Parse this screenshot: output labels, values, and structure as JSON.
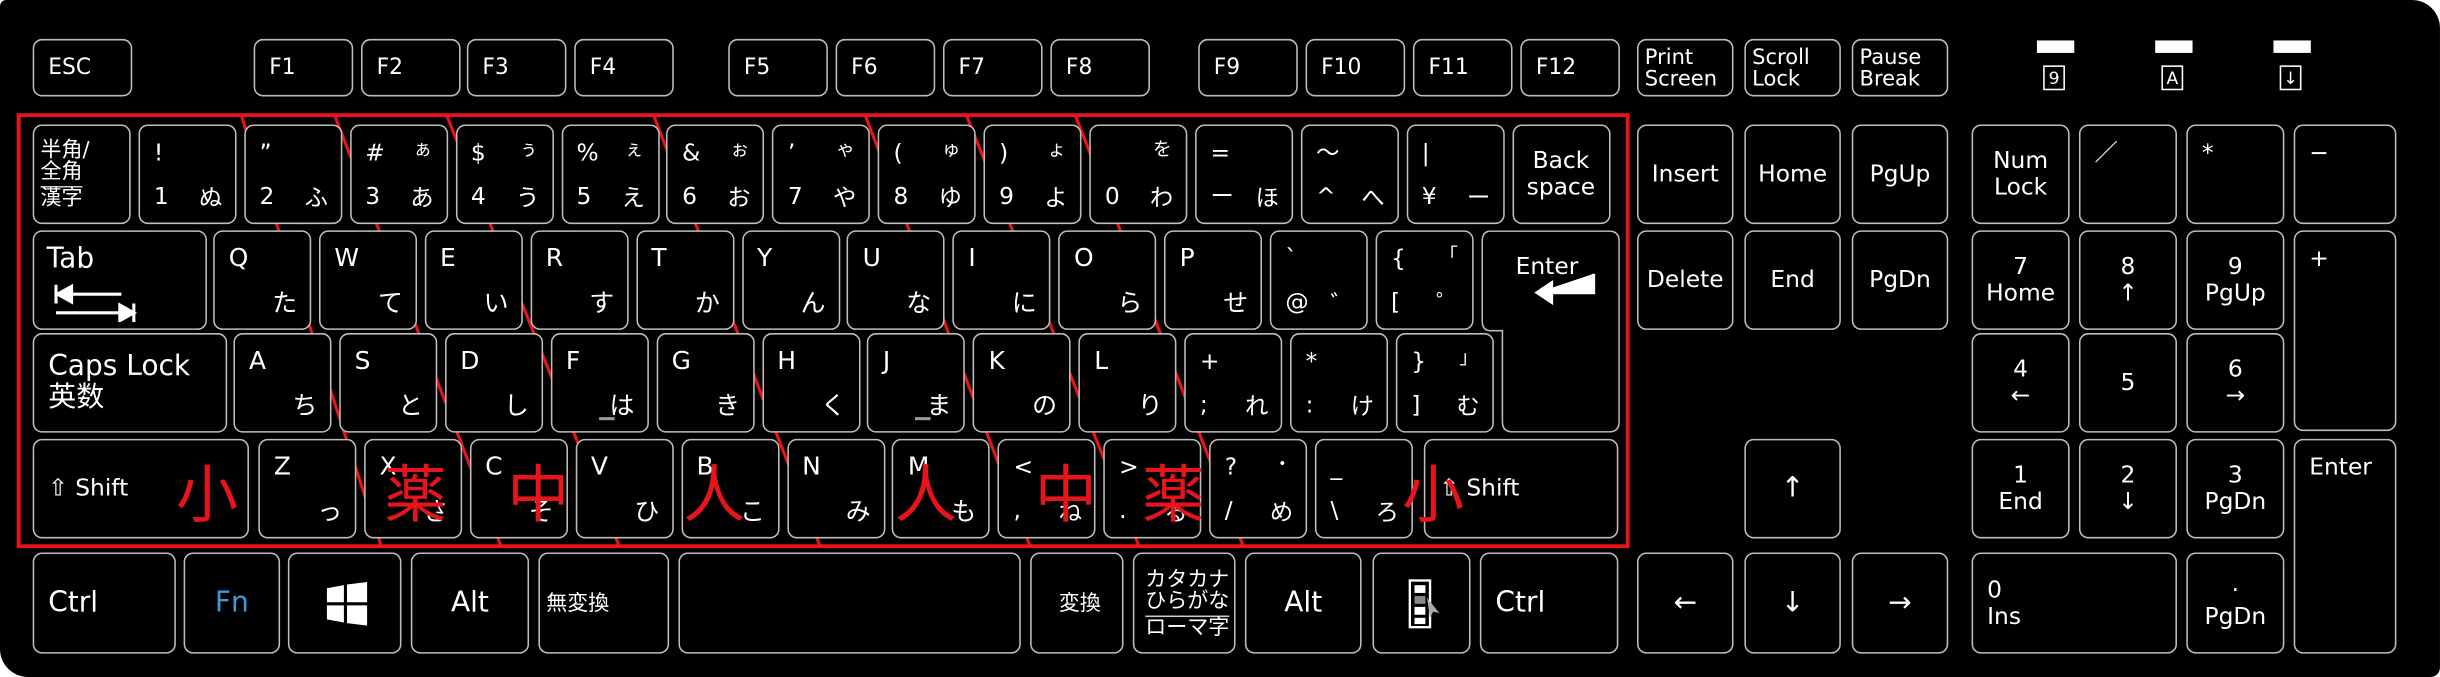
{
  "accent_colors": {
    "overlay_red": "#e8141c",
    "fn_blue": "#3d9ad8",
    "key_border": "#bdbdbd",
    "keyboard_body": "#000000"
  },
  "function_row": [
    {
      "lines": [
        "ESC"
      ]
    },
    {
      "lines": [
        "F1"
      ]
    },
    {
      "lines": [
        "F2"
      ]
    },
    {
      "lines": [
        "F3"
      ]
    },
    {
      "lines": [
        "F4"
      ]
    },
    {
      "lines": [
        "F5"
      ]
    },
    {
      "lines": [
        "F6"
      ]
    },
    {
      "lines": [
        "F7"
      ]
    },
    {
      "lines": [
        "F8"
      ]
    },
    {
      "lines": [
        "F9"
      ]
    },
    {
      "lines": [
        "F10"
      ]
    },
    {
      "lines": [
        "F11"
      ]
    },
    {
      "lines": [
        "F12"
      ]
    },
    {
      "lines": [
        "Print",
        "Screen"
      ]
    },
    {
      "lines": [
        "Scroll",
        "Lock"
      ]
    },
    {
      "lines": [
        "Pause",
        "Break"
      ]
    }
  ],
  "indicators": [
    {
      "symbol": "9",
      "name": "num-lock"
    },
    {
      "symbol": "A",
      "name": "caps-lock"
    },
    {
      "symbol": "↓",
      "name": "scroll-lock"
    }
  ],
  "main": {
    "row1": [
      {
        "lines": [
          "半角/",
          "全角",
          "漢字"
        ]
      },
      {
        "tl": "!",
        "bl": "1",
        "br": "ぬ"
      },
      {
        "tl": "”",
        "bl": "2",
        "br": "ふ"
      },
      {
        "tl": "#",
        "tr": "ぁ",
        "bl": "3",
        "br": "あ"
      },
      {
        "tl": "$",
        "tr": "ぅ",
        "bl": "4",
        "br": "う"
      },
      {
        "tl": "%",
        "tr": "ぇ",
        "bl": "5",
        "br": "え"
      },
      {
        "tl": "&",
        "tr": "ぉ",
        "bl": "6",
        "br": "お"
      },
      {
        "tl": "’",
        "tr": "ゃ",
        "bl": "7",
        "br": "や"
      },
      {
        "tl": "(",
        "tr": "ゅ",
        "bl": "8",
        "br": "ゆ"
      },
      {
        "tl": ")",
        "tr": "ょ",
        "bl": "9",
        "br": "よ"
      },
      {
        "tr": "を",
        "bl": "0",
        "br": "わ"
      },
      {
        "tl": "=",
        "bl": "ー",
        "br": "ほ"
      },
      {
        "tl": "～",
        "bl": "^",
        "br": "へ"
      },
      {
        "tl": "|",
        "bl": "¥",
        "br": "ー"
      },
      {
        "lines": [
          "Back",
          "space"
        ]
      }
    ],
    "row2": [
      {
        "lines": [
          "Tab"
        ]
      },
      {
        "tl": "Q",
        "br": "た"
      },
      {
        "tl": "W",
        "br": "て"
      },
      {
        "tl": "E",
        "br": "い"
      },
      {
        "tl": "R",
        "br": "す"
      },
      {
        "tl": "T",
        "br": "か"
      },
      {
        "tl": "Y",
        "br": "ん"
      },
      {
        "tl": "U",
        "br": "な"
      },
      {
        "tl": "I",
        "br": "に"
      },
      {
        "tl": "O",
        "br": "ら"
      },
      {
        "tl": "P",
        "br": "せ"
      },
      {
        "tl": "`",
        "bl": "@",
        "br": "゛"
      },
      {
        "tl": "{",
        "tr": "「",
        "bl": "[",
        "br": "゜"
      }
    ],
    "enter": {
      "label": "Enter"
    },
    "row3": [
      {
        "lines": [
          "Caps Lock",
          "英数"
        ]
      },
      {
        "tl": "A",
        "br": "ち"
      },
      {
        "tl": "S",
        "br": "と"
      },
      {
        "tl": "D",
        "br": "し"
      },
      {
        "tl": "F",
        "br": "は"
      },
      {
        "tl": "G",
        "br": "き"
      },
      {
        "tl": "H",
        "br": "く"
      },
      {
        "tl": "J",
        "br": "ま"
      },
      {
        "tl": "K",
        "br": "の"
      },
      {
        "tl": "L",
        "br": "り"
      },
      {
        "tl": "+",
        "bl": ";",
        "br": "れ"
      },
      {
        "tl": "*",
        "bl": ":",
        "br": "け"
      },
      {
        "tl": "}",
        "tr": "」",
        "bl": "]",
        "br": "む"
      }
    ],
    "row4": [
      {
        "lines": [
          "⇧ Shift"
        ]
      },
      {
        "tl": "Z",
        "br": "っ"
      },
      {
        "tl": "X",
        "br": "さ"
      },
      {
        "tl": "C",
        "br": "そ"
      },
      {
        "tl": "V",
        "br": "ひ"
      },
      {
        "tl": "B",
        "br": "こ"
      },
      {
        "tl": "N",
        "br": "み"
      },
      {
        "tl": "M",
        "br": "も"
      },
      {
        "tl": "<",
        "bl": ",",
        "br": "ね"
      },
      {
        "tl": ">",
        "bl": ".",
        "br": "る"
      },
      {
        "tl": "?",
        "tr": "・",
        "bl": "/",
        "br": "め"
      },
      {
        "tl": "_",
        "bl": "\\",
        "br": "ろ"
      },
      {
        "lines": [
          "⇧ Shift"
        ]
      }
    ],
    "row5": [
      {
        "lines": [
          "Ctrl"
        ]
      },
      {
        "lines": [
          "Fn"
        ]
      },
      {
        "icon": "windows-icon"
      },
      {
        "lines": [
          "Alt"
        ]
      },
      {
        "lines": [
          "無変換"
        ]
      },
      {
        "lines": [
          ""
        ]
      },
      {
        "lines": [
          "変換"
        ]
      },
      {
        "lines": [
          "カタカナ",
          "ひらがな",
          "ローマ字"
        ]
      },
      {
        "lines": [
          "Alt"
        ]
      },
      {
        "icon": "context-menu-icon"
      },
      {
        "lines": [
          "Ctrl"
        ]
      }
    ]
  },
  "nav": [
    {
      "lines": [
        "Insert"
      ]
    },
    {
      "lines": [
        "Home"
      ]
    },
    {
      "lines": [
        "PgUp"
      ]
    },
    {
      "lines": [
        "Delete"
      ]
    },
    {
      "lines": [
        "End"
      ]
    },
    {
      "lines": [
        "PgDn"
      ]
    },
    {
      "lines": [
        "↑"
      ]
    },
    {
      "lines": [
        "←"
      ]
    },
    {
      "lines": [
        "↓"
      ]
    },
    {
      "lines": [
        "→"
      ]
    }
  ],
  "numpad": [
    {
      "lines": [
        "Num",
        "Lock"
      ]
    },
    {
      "tl": "／"
    },
    {
      "tl": "*"
    },
    {
      "tl": "−"
    },
    {
      "lines": [
        "7",
        "Home"
      ]
    },
    {
      "lines": [
        "8",
        "↑"
      ]
    },
    {
      "lines": [
        "9",
        "PgUp"
      ]
    },
    {
      "tl": "+"
    },
    {
      "lines": [
        "4",
        "←"
      ]
    },
    {
      "lines": [
        "5",
        ""
      ]
    },
    {
      "lines": [
        "6",
        "→"
      ]
    },
    {
      "lines": [
        "1",
        "End"
      ]
    },
    {
      "lines": [
        "2",
        "↓"
      ]
    },
    {
      "lines": [
        "3",
        "PgDn"
      ]
    },
    {
      "tl": "Enter"
    },
    {
      "lines": [
        "0",
        "Ins"
      ]
    },
    {
      "lines": [
        "·",
        "PgDn"
      ]
    }
  ],
  "overlay_labels": [
    "小",
    "薬",
    "中",
    "人",
    "人",
    "中",
    "薬",
    "小"
  ]
}
